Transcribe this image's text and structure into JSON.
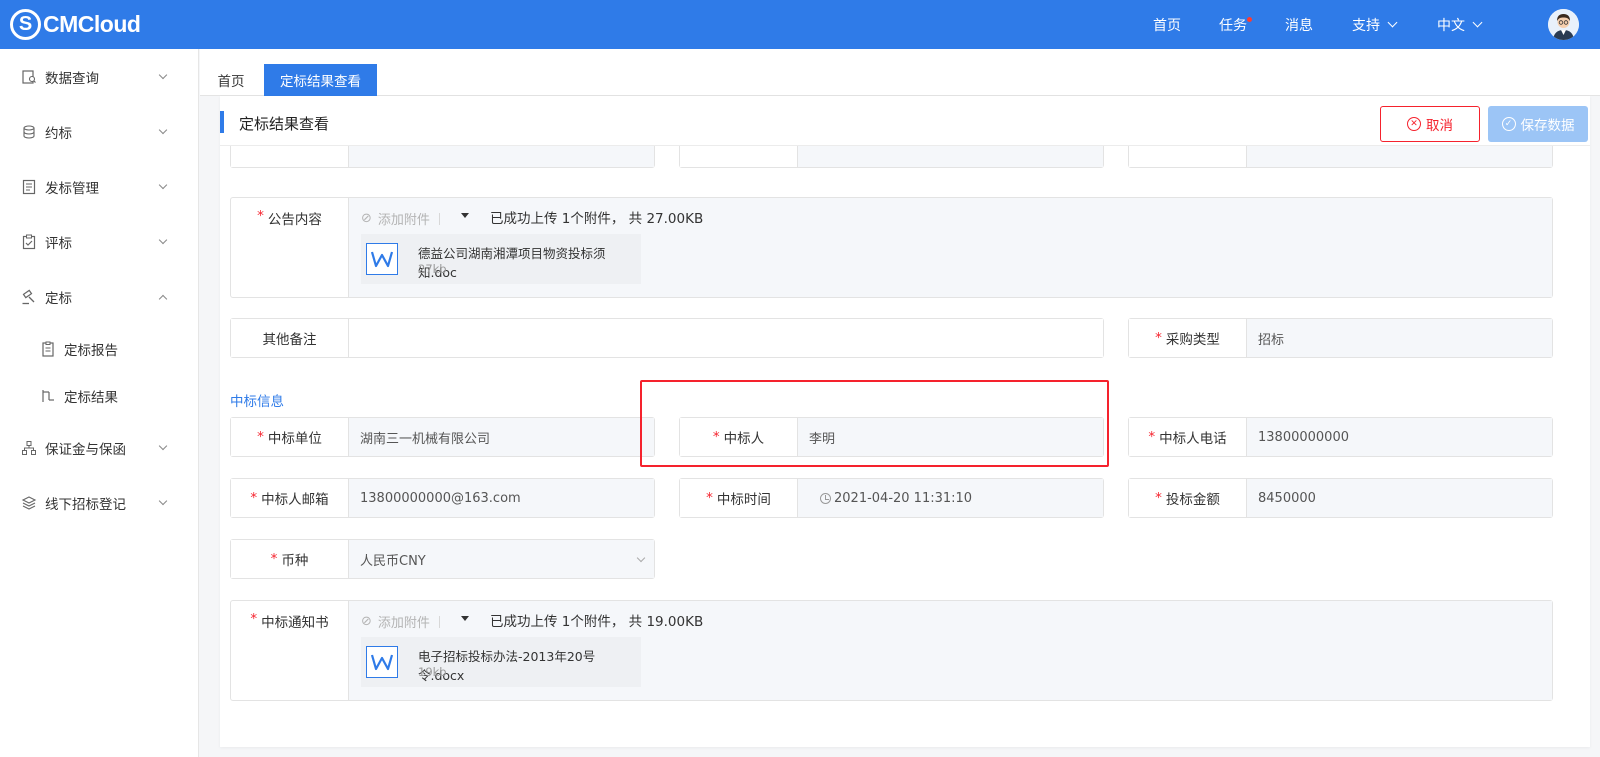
{
  "header": {
    "logo_mark": "S",
    "logo_text": "CMCloud",
    "nav": {
      "home": "首页",
      "tasks": "任务",
      "messages": "消息",
      "support": "支持",
      "language": "中文"
    }
  },
  "sidebar": {
    "items": [
      {
        "label": "数据查询",
        "icon": "database-search-icon"
      },
      {
        "label": "约标",
        "icon": "coins-icon"
      },
      {
        "label": "发标管理",
        "icon": "document-icon"
      },
      {
        "label": "评标",
        "icon": "clipboard-check-icon"
      },
      {
        "label": "定标",
        "icon": "gavel-icon"
      },
      {
        "label": "定标报告",
        "icon": "report-icon"
      },
      {
        "label": "定标结果",
        "icon": "result-icon"
      },
      {
        "label": "保证金与保函",
        "icon": "org-chart-icon"
      },
      {
        "label": "线下招标登记",
        "icon": "layers-icon"
      }
    ]
  },
  "tabs": {
    "home": "首页",
    "active": "定标结果查看"
  },
  "page": {
    "title": "定标结果查看",
    "cancel": "取消",
    "save": "保存数据"
  },
  "form": {
    "announcement": {
      "label": "公告内容",
      "add_attachment": "添加附件",
      "upload_info": "已成功上传 1个附件， 共 27.00KB",
      "file_name": "德益公司湖南湘潭项目物资投标须知.doc",
      "file_size": "27kb"
    },
    "other_notes": {
      "label": "其他备注",
      "value": ""
    },
    "purchase_type": {
      "label": "采购类型",
      "value": "招标"
    },
    "section_winner": "中标信息",
    "winning_unit": {
      "label": "中标单位",
      "value": "湖南三一机械有限公司"
    },
    "winner": {
      "label": "中标人",
      "value": "李明"
    },
    "winner_phone": {
      "label": "中标人电话",
      "value": "13800000000"
    },
    "winner_email": {
      "label": "中标人邮箱",
      "value": "13800000000@163.com"
    },
    "win_time": {
      "label": "中标时间",
      "value": "2021-04-20 11:31:10"
    },
    "bid_amount": {
      "label": "投标金额",
      "value": "8450000"
    },
    "currency": {
      "label": "币种",
      "value": "人民币CNY"
    },
    "notice": {
      "label": "中标通知书",
      "add_attachment": "添加附件",
      "upload_info": "已成功上传 1个附件， 共 19.00KB",
      "file_name": "电子招标投标办法-2013年20号令.docx",
      "file_size": "19kb"
    }
  },
  "colors": {
    "primary": "#2f7be8",
    "danger": "#f5222d",
    "save_disabled": "#9cc5f6"
  }
}
